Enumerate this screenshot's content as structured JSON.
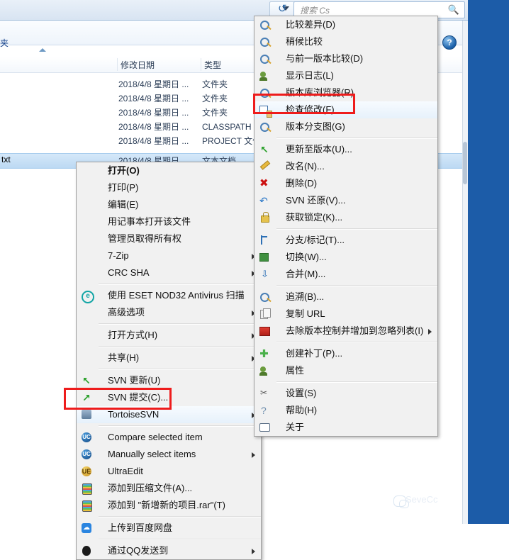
{
  "explorer": {
    "search": {
      "placeholder": "搜索 Cs",
      "icon": "search-icon"
    },
    "toolbar_label": "夹",
    "help_icon": "?",
    "columns": [
      {
        "label": ""
      },
      {
        "label": "修改日期"
      },
      {
        "label": "类型"
      }
    ],
    "rows": [
      {
        "name": "",
        "date": "2018/4/8 星期日 ...",
        "type": "文件夹"
      },
      {
        "name": "",
        "date": "2018/4/8 星期日 ...",
        "type": "文件夹"
      },
      {
        "name": "",
        "date": "2018/4/8 星期日 ...",
        "type": "文件夹"
      },
      {
        "name": "",
        "date": "2018/4/8 星期日 ...",
        "type": "CLASSPATH 文"
      },
      {
        "name": "",
        "date": "2018/4/8 星期日 ...",
        "type": "PROJECT 文件"
      },
      {
        "name": "txt",
        "date": "2018/4/8 星期日",
        "type": "文本文档"
      }
    ]
  },
  "context_menu": {
    "items": [
      {
        "label": "打开(O)",
        "icon": "",
        "bold": true,
        "submenu": false,
        "sep_after": false
      },
      {
        "label": "打印(P)",
        "icon": "",
        "bold": false,
        "submenu": false,
        "sep_after": false
      },
      {
        "label": "编辑(E)",
        "icon": "",
        "bold": false,
        "submenu": false,
        "sep_after": false
      },
      {
        "label": "用记事本打开该文件",
        "icon": "",
        "bold": false,
        "submenu": false,
        "sep_after": false
      },
      {
        "label": "管理员取得所有权",
        "icon": "",
        "bold": false,
        "submenu": false,
        "sep_after": false
      },
      {
        "label": "7-Zip",
        "icon": "",
        "bold": false,
        "submenu": true,
        "sep_after": false
      },
      {
        "label": "CRC SHA",
        "icon": "",
        "bold": false,
        "submenu": true,
        "sep_after": true
      },
      {
        "label": "使用 ESET NOD32 Antivirus 扫描",
        "icon": "eset-icon",
        "bold": false,
        "submenu": false,
        "sep_after": false
      },
      {
        "label": "高级选项",
        "icon": "",
        "bold": false,
        "submenu": true,
        "sep_after": true
      },
      {
        "label": "打开方式(H)",
        "icon": "",
        "bold": false,
        "submenu": true,
        "sep_after": true
      },
      {
        "label": "共享(H)",
        "icon": "",
        "bold": false,
        "submenu": true,
        "sep_after": true
      },
      {
        "label": "SVN 更新(U)",
        "icon": "svn-update-icon",
        "bold": false,
        "submenu": false,
        "sep_after": false
      },
      {
        "label": "SVN 提交(C)...",
        "icon": "svn-commit-icon",
        "bold": false,
        "submenu": false,
        "sep_after": false
      },
      {
        "label": "TortoiseSVN",
        "icon": "tortoisesvn-icon",
        "bold": false,
        "submenu": true,
        "sep_after": true,
        "highlighted": true
      },
      {
        "label": "Compare selected item",
        "icon": "ultracompare-icon",
        "bold": false,
        "submenu": false,
        "sep_after": false
      },
      {
        "label": "Manually select items",
        "icon": "ultracompare-icon",
        "bold": false,
        "submenu": true,
        "sep_after": false
      },
      {
        "label": "UltraEdit",
        "icon": "ultraedit-icon",
        "bold": false,
        "submenu": false,
        "sep_after": false
      },
      {
        "label": "添加到压缩文件(A)...",
        "icon": "winrar-icon",
        "bold": false,
        "submenu": false,
        "sep_after": false
      },
      {
        "label": "添加到 \"新增新的项目.rar\"(T)",
        "icon": "winrar-icon",
        "bold": false,
        "submenu": false,
        "sep_after": true
      },
      {
        "label": "上传到百度网盘",
        "icon": "baidu-netdisk-icon",
        "bold": false,
        "submenu": false,
        "sep_after": true
      },
      {
        "label": "通过QQ发送到",
        "icon": "qq-icon",
        "bold": false,
        "submenu": true,
        "sep_after": false
      }
    ]
  },
  "tortoisesvn_submenu": {
    "items": [
      {
        "label": "比较差异(D)",
        "icon": "diff-icon",
        "submenu": false,
        "sep_after": false
      },
      {
        "label": "稍候比较",
        "icon": "diff-later-icon",
        "submenu": false,
        "sep_after": false
      },
      {
        "label": "与前一版本比较(D)",
        "icon": "diff-prev-icon",
        "submenu": false,
        "sep_after": false
      },
      {
        "label": "显示日志(L)",
        "icon": "show-log-icon",
        "submenu": false,
        "sep_after": false
      },
      {
        "label": "版本库浏览器(R)",
        "icon": "repo-browser-icon",
        "submenu": false,
        "sep_after": false
      },
      {
        "label": "检查修改(F)",
        "icon": "check-modifications-icon",
        "submenu": false,
        "sep_after": false,
        "highlighted": true
      },
      {
        "label": "版本分支图(G)",
        "icon": "revision-graph-icon",
        "submenu": false,
        "sep_after": true
      },
      {
        "label": "更新至版本(U)...",
        "icon": "update-to-revision-icon",
        "submenu": false,
        "sep_after": false
      },
      {
        "label": "改名(N)...",
        "icon": "rename-icon",
        "submenu": false,
        "sep_after": false
      },
      {
        "label": "删除(D)",
        "icon": "delete-icon",
        "submenu": false,
        "sep_after": false
      },
      {
        "label": "SVN 还原(V)...",
        "icon": "revert-icon",
        "submenu": false,
        "sep_after": false
      },
      {
        "label": "获取锁定(K)...",
        "icon": "lock-icon",
        "submenu": false,
        "sep_after": true
      },
      {
        "label": "分支/标记(T)...",
        "icon": "branch-tag-icon",
        "submenu": false,
        "sep_after": false
      },
      {
        "label": "切换(W)...",
        "icon": "switch-icon",
        "submenu": false,
        "sep_after": false
      },
      {
        "label": "合并(M)...",
        "icon": "merge-icon",
        "submenu": false,
        "sep_after": true
      },
      {
        "label": "追溯(B)...",
        "icon": "blame-icon",
        "submenu": false,
        "sep_after": false
      },
      {
        "label": "复制 URL",
        "icon": "copy-url-icon",
        "submenu": false,
        "sep_after": false
      },
      {
        "label": "去除版本控制并增加到忽略列表(I)",
        "icon": "unversion-ignore-icon",
        "submenu": true,
        "sep_after": true
      },
      {
        "label": "创建补丁(P)...",
        "icon": "create-patch-icon",
        "submenu": false,
        "sep_after": false
      },
      {
        "label": "属性",
        "icon": "properties-icon",
        "submenu": false,
        "sep_after": true
      },
      {
        "label": "设置(S)",
        "icon": "settings-icon",
        "submenu": false,
        "sep_after": false
      },
      {
        "label": "帮助(H)",
        "icon": "help-icon",
        "submenu": false,
        "sep_after": false
      },
      {
        "label": "关于",
        "icon": "about-icon",
        "submenu": false,
        "sep_after": false
      }
    ]
  },
  "watermark": {
    "text": "SeveCc",
    "icon": "wechat-icon"
  },
  "colors": {
    "highlight_box": "#ee1c1c",
    "desktop": "#1c5ca8",
    "menu_bg": "#f1f1f1"
  }
}
